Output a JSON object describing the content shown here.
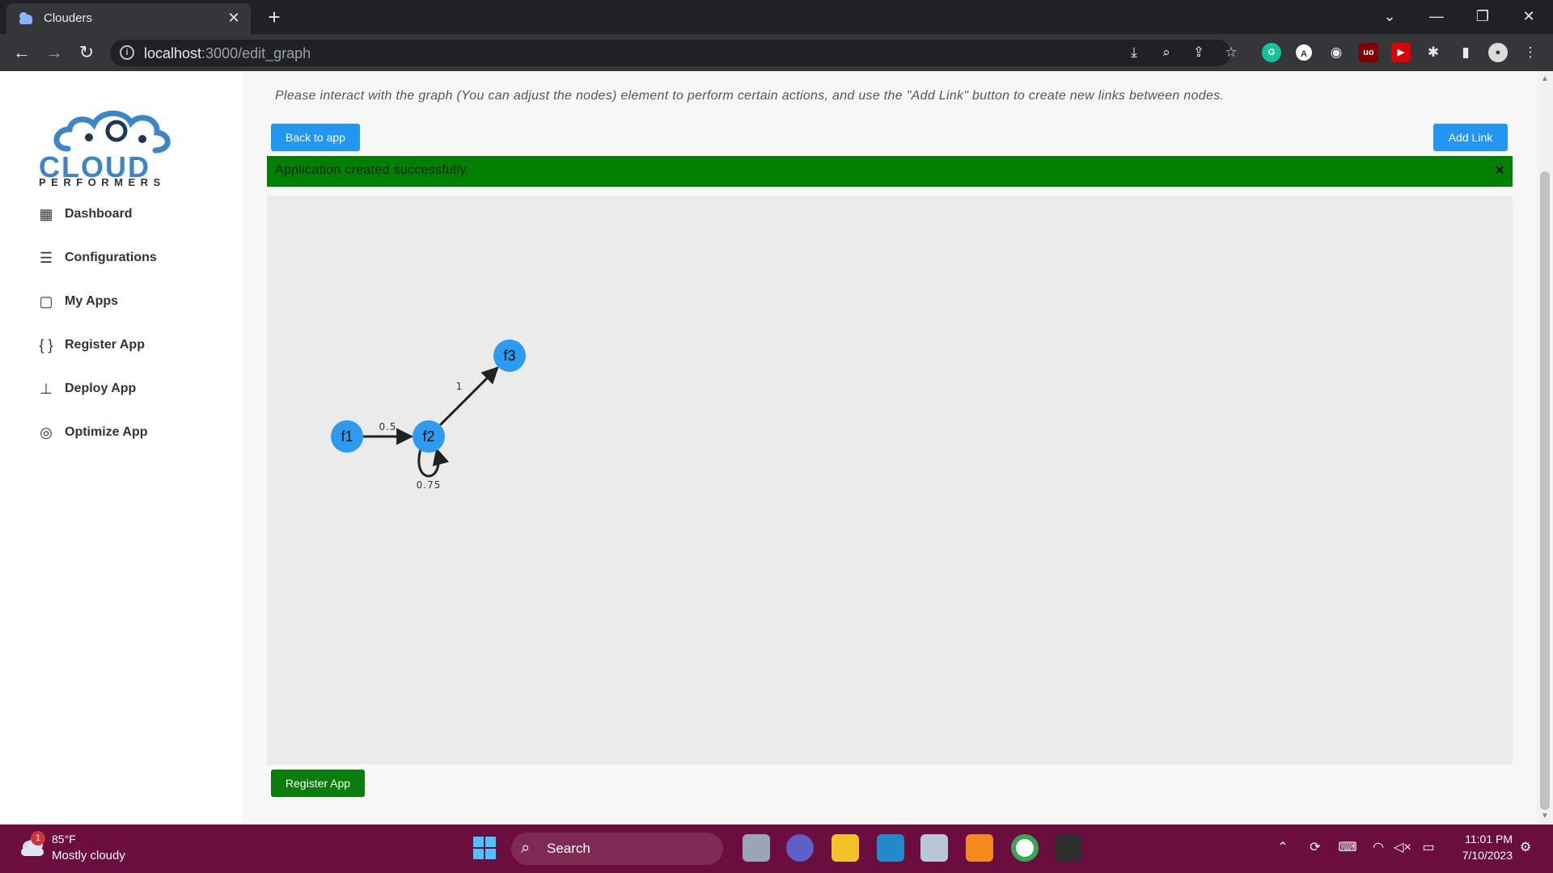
{
  "browser": {
    "tab_title": "Clouders",
    "url_host": "localhost",
    "url_path": ":3000/edit_graph"
  },
  "sidebar": {
    "logo_text": "CLOUD",
    "logo_sub": "PERFORMERS",
    "items": [
      {
        "label": "Dashboard",
        "icon": "dashboard-icon"
      },
      {
        "label": "Configurations",
        "icon": "configurations-icon"
      },
      {
        "label": "My Apps",
        "icon": "clipboard-icon"
      },
      {
        "label": "Register App",
        "icon": "braces-icon"
      },
      {
        "label": "Deploy App",
        "icon": "sitemap-icon"
      },
      {
        "label": "Optimize App",
        "icon": "optimize-icon"
      }
    ]
  },
  "main": {
    "instructions": "Please interact with the graph (You can adjust the nodes) element to perform certain actions, and use the \"Add Link\" button to create new links between nodes.",
    "back_button": "Back to app",
    "add_link_button": "Add Link",
    "alert_text": "Application created successfully.",
    "alert_close": "×",
    "register_button": "Register App"
  },
  "graph": {
    "nodes": [
      {
        "id": "f1",
        "label": "f1"
      },
      {
        "id": "f2",
        "label": "f2"
      },
      {
        "id": "f3",
        "label": "f3"
      }
    ],
    "links": [
      {
        "source": "f1",
        "target": "f2",
        "label": "0.5"
      },
      {
        "source": "f2",
        "target": "f3",
        "label": "1"
      },
      {
        "source": "f2",
        "target": "f2",
        "label": "0.75"
      }
    ]
  },
  "taskbar": {
    "weather_temp": "85°F",
    "weather_desc": "Mostly cloudy",
    "weather_badge": "1",
    "search_label": "Search",
    "time": "11:01 PM",
    "date": "7/10/2023"
  },
  "colors": {
    "accent": "#2196f3",
    "success": "#008000",
    "node": "#2d9cf0",
    "taskbar": "#6b0d3e"
  }
}
